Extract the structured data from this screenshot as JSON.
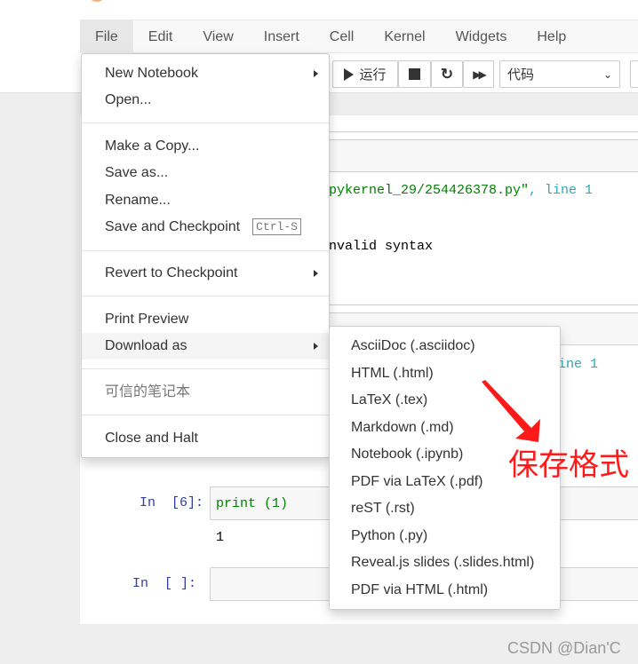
{
  "menubar": [
    "File",
    "Edit",
    "View",
    "Insert",
    "Cell",
    "Kernel",
    "Widgets",
    "Help"
  ],
  "toolbar": {
    "run_label": "运行",
    "cell_type": "代码"
  },
  "file_menu": {
    "new_notebook": "New Notebook",
    "open": "Open...",
    "make_copy": "Make a Copy...",
    "save_as": "Save as...",
    "rename": "Rename...",
    "save_checkpoint": "Save and Checkpoint",
    "save_shortcut": "Ctrl-S",
    "revert": "Revert to Checkpoint",
    "print_preview": "Print Preview",
    "download_as": "Download as",
    "trusted": "可信的笔记本",
    "close_halt": "Close and Halt"
  },
  "download_submenu": [
    "AsciiDoc (.asciidoc)",
    "HTML (.html)",
    "LaTeX (.tex)",
    "Markdown (.md)",
    "Notebook (.ipynb)",
    "PDF via LaTeX (.pdf)",
    "reST (.rst)",
    "Python (.py)",
    "Reveal.js slides (.slides.html)",
    "PDF via HTML (.html)"
  ],
  "cells": {
    "c1_file": "pykernel_29/254426378.py\"",
    "c1_line": ", line 1",
    "c1_err": "nvalid syntax",
    "c2_line": "ine 1",
    "c3_prompt_in": "In",
    "c3_prompt_num": "[6]:",
    "c3_code_kw": "print",
    "c3_code_arg": " (1)",
    "c3_output": "1",
    "c4_prompt_in": "In",
    "c4_prompt_num": "[ ]:"
  },
  "annotation": "保存格式",
  "watermark": "CSDN @Dian'C",
  "colors": {
    "annotation": "#ff1a1a",
    "prompt": "#303f9f",
    "green": "#008000"
  }
}
